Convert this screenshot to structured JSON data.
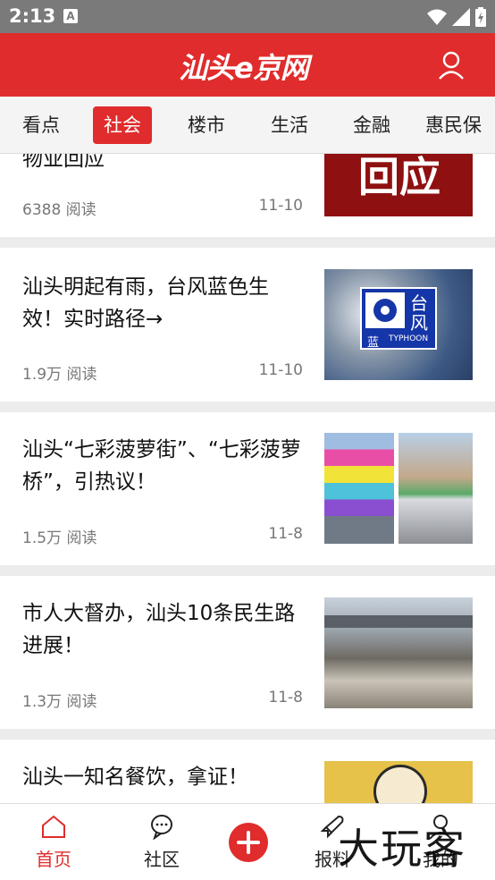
{
  "status_bar": {
    "time": "2:13",
    "notification_glyph": "A"
  },
  "header": {
    "logo_text": "汕头e京网",
    "brand_color": "#e02c2c"
  },
  "tabs": [
    {
      "label": "看点"
    },
    {
      "label": "社会",
      "active": true
    },
    {
      "label": "楼市"
    },
    {
      "label": "生活"
    },
    {
      "label": "金融"
    },
    {
      "label": "惠民保"
    }
  ],
  "feed": [
    {
      "title": "物业回应",
      "reads": "6388 阅读",
      "date": "11-10",
      "thumb_text": "回应"
    },
    {
      "title": "汕头明起有雨，台风蓝色生效！实时路径→",
      "reads": "1.9万 阅读",
      "date": "11-10",
      "thumb_badge_top": "台",
      "thumb_badge_mid": "风",
      "thumb_badge_left": "蓝",
      "thumb_badge_right": "TYPHOON"
    },
    {
      "title": "汕头“七彩菠萝街”、“七彩菠萝桥”，引热议！",
      "reads": "1.5万 阅读",
      "date": "11-8"
    },
    {
      "title": "市人大督办，汕头10条民生路进展！",
      "reads": "1.3万 阅读",
      "date": "11-8"
    },
    {
      "title": "汕头一知名餐饮，拿证！"
    }
  ],
  "bottom_nav": {
    "home": "首页",
    "community": "社区",
    "report": "报料",
    "mine": "我的"
  },
  "watermark": "大玩客"
}
